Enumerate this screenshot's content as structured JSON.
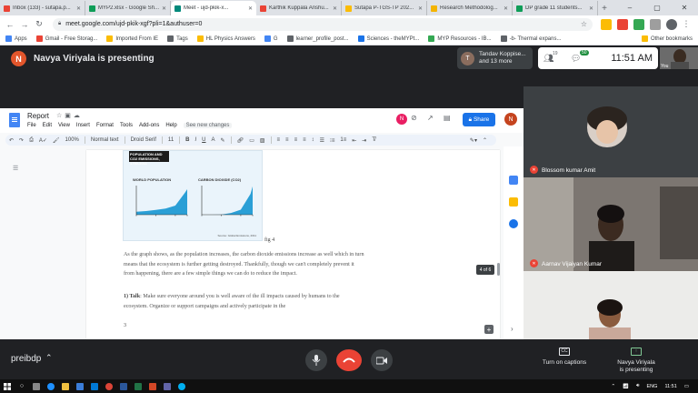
{
  "browser": {
    "tabs": [
      {
        "title": "Inbox (133) - sutapa.p...",
        "fav": "#ea4335",
        "active": false
      },
      {
        "title": "MYP2.xlsx - Google Sh...",
        "fav": "#0f9d58",
        "active": false
      },
      {
        "title": "Meet - ujd-pkik-x...",
        "fav": "#00897b",
        "active": true
      },
      {
        "title": "Karthik Kuppala Anshu...",
        "fav": "#ea4335",
        "active": false
      },
      {
        "title": "Sutapa P-TGS-TP 202...",
        "fav": "#fbbc04",
        "active": false
      },
      {
        "title": "Research Methodolog...",
        "fav": "#f4b400",
        "active": false
      },
      {
        "title": "DP grade 11 students...",
        "fav": "#0f9d58",
        "active": false
      }
    ],
    "new_tab": "+",
    "url": "meet.google.com/ujd-pkik-xgf?pli=1&authuser=0",
    "bookmarks": [
      "Apps",
      "Gmail - Free Storag...",
      "Imported From IE",
      "Tags",
      "HL Physics Answers",
      "G",
      "learner_profile_post...",
      "Sciences - theMYPt...",
      "MYP Resources - IB...",
      "-b- Thermal expans..."
    ],
    "other_bookmarks": "Other bookmarks"
  },
  "meet": {
    "presenter_initial": "N",
    "presenter_text": "Navya Viriyala is presenting",
    "participants_chip": {
      "initial": "T",
      "line1": "Tandav Koppise...",
      "line2": "and 13 more"
    },
    "people_count": "19",
    "chat_count": "50",
    "clock": "11:51 AM",
    "you_label": "You",
    "meeting_code": "preibdp",
    "captions_label": "Turn on captions",
    "presenting_label_line1": "Navya Viriyala",
    "presenting_label_line2": "is presenting",
    "tiles": [
      {
        "name": "Blossom kumar Amit"
      },
      {
        "name": "Aarnav Vijaiyan Kumar"
      },
      {
        "name": ""
      }
    ]
  },
  "doc": {
    "title": "Report",
    "menu": [
      "File",
      "Edit",
      "View",
      "Insert",
      "Format",
      "Tools",
      "Add-ons",
      "Help"
    ],
    "changes": "See new changes",
    "share": "Share",
    "account_initial": "N",
    "toolbar": {
      "zoom": "100%",
      "style": "Normal text",
      "font": "Droid Serif",
      "size": "11"
    },
    "figure_caption": "fig 4",
    "chart_heading": "POPULATION AND CO2 EMISSIONS, 1750-2011",
    "chart_source": "Source: Global Emissions, 2011",
    "paragraph1": "As the graph shows, as the population increases, the carbon dioxide emissions increase as well which in turn means that the ecosystem is further getting destroyed. Thankfully, though we can't completely prevent it from happening, there are a few simple things we can do to reduce the impact.",
    "talk_label": "1) Talk",
    "paragraph2": ": Make sure everyone around you is well aware of the ill impacts caused by humans to the ecosystem. Organize or support campaigns and actively participate in the",
    "page_number": "3",
    "page_indicator": "4 of 6"
  },
  "chart_data": [
    {
      "type": "area",
      "title": "WORLD POPULATION",
      "x": [
        1750,
        1800,
        1850,
        1900,
        1950,
        2000,
        2011
      ],
      "series": [
        {
          "values": [
            0.8,
            1.0,
            1.3,
            1.7,
            2.5,
            6.1,
            7.0
          ]
        }
      ],
      "ylim": [
        0,
        8
      ]
    },
    {
      "type": "area",
      "title": "CARBON DIOXIDE (CO2)",
      "x": [
        1750,
        1800,
        1850,
        1900,
        1950,
        2000,
        2011
      ],
      "series": [
        {
          "values": [
            0.01,
            0.03,
            0.2,
            2.0,
            6.0,
            25.0,
            34.0
          ]
        }
      ],
      "ylim": [
        0,
        35
      ]
    }
  ],
  "taskbar": {
    "lang": "ENG",
    "time": "11:51"
  },
  "colors": {
    "meet_bg": "#202124",
    "share_blue": "#1a73e8",
    "end_red": "#ea4335",
    "chart_fill": "#2a9fd6"
  }
}
